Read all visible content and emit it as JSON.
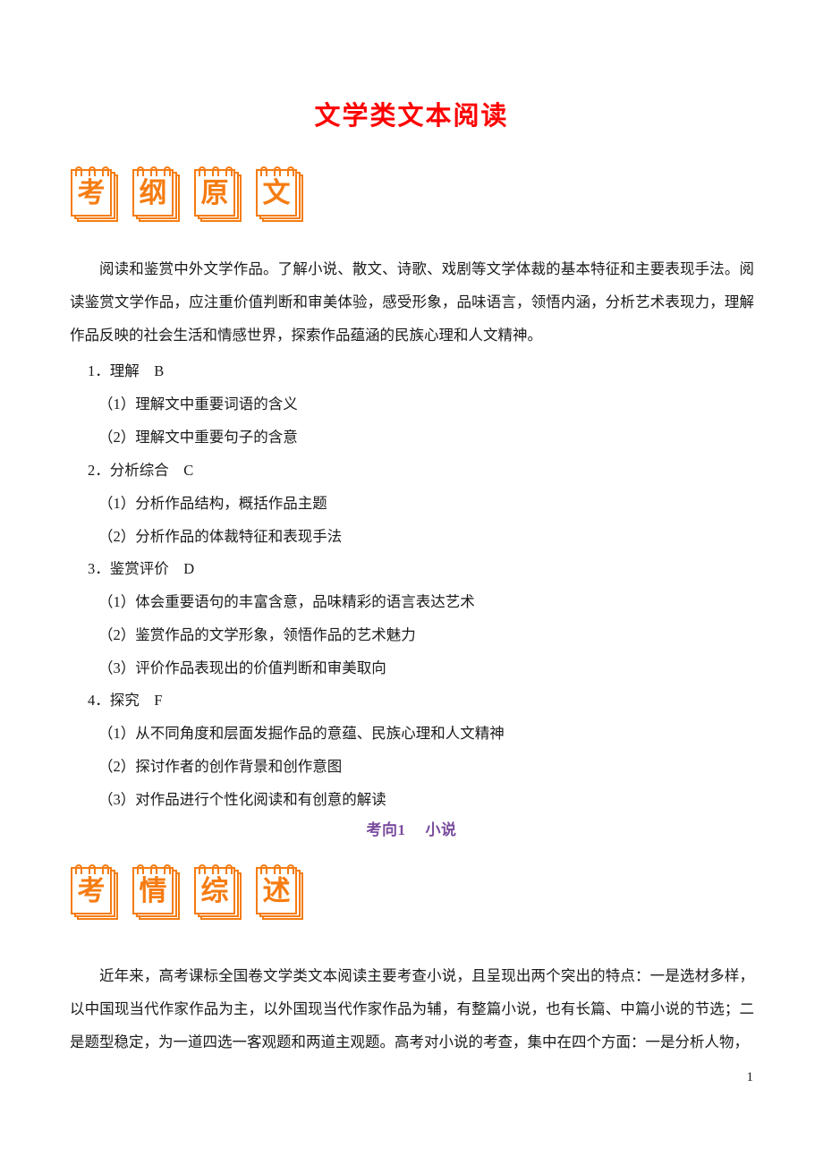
{
  "document": {
    "title": "文学类文本阅读",
    "page_number": "1"
  },
  "banners": [
    {
      "name": "kaogang-yuanwen",
      "chars": [
        "考",
        "纲",
        "原",
        "文"
      ]
    },
    {
      "name": "kaoqing-zongshu",
      "chars": [
        "考",
        "情",
        "综",
        "述"
      ]
    }
  ],
  "intro_paragraph": "阅读和鉴赏中外文学作品。了解小说、散文、诗歌、戏剧等文学体裁的基本特征和主要表现手法。阅读鉴赏文学作品，应注重价值判断和审美体验，感受形象，品味语言，领悟内涵，分析艺术表现力，理解作品反映的社会生活和情感世界，探索作品蕴涵的民族心理和人文精神。",
  "outline": [
    {
      "level": 1,
      "text": "1．理解　B"
    },
    {
      "level": 2,
      "text": "（1）理解文中重要词语的含义"
    },
    {
      "level": 2,
      "text": "（2）理解文中重要句子的含意"
    },
    {
      "level": 1,
      "text": "2．分析综合　C"
    },
    {
      "level": 2,
      "text": "（1）分析作品结构，概括作品主题"
    },
    {
      "level": 2,
      "text": "（2）分析作品的体裁特征和表现手法"
    },
    {
      "level": 1,
      "text": "3．鉴赏评价　D"
    },
    {
      "level": 2,
      "text": "（1）体会重要语句的丰富含意，品味精彩的语言表达艺术"
    },
    {
      "level": 2,
      "text": "（2）鉴赏作品的文学形象，领悟作品的艺术魅力"
    },
    {
      "level": 2,
      "text": "（3）评价作品表现出的价值判断和审美取向"
    },
    {
      "level": 1,
      "text": "4．探究　F"
    },
    {
      "level": 2,
      "text": "（1）从不同角度和层面发掘作品的意蕴、民族心理和人文精神"
    },
    {
      "level": 2,
      "text": "（2）探讨作者的创作背景和创作意图"
    },
    {
      "level": 2,
      "text": "（3）对作品进行个性化阅读和有创意的解读"
    }
  ],
  "section_heading": {
    "label": "考向1",
    "title": "小说"
  },
  "outro_paragraph": "近年来，高考课标全国卷文学类文本阅读主要考查小说，且呈现出两个突出的特点：一是选材多样，以中国现当代作家作品为主，以外国现当代作家作品为辅，有整篇小说，也有长篇、中篇小说的节选；二是题型稳定，为一道四选一客观题和两道主观题。高考对小说的考查，集中在四个方面：一是分析人物，",
  "colors": {
    "title_red": "#FF0000",
    "banner_orange": "#F57C12",
    "heading_purple": "#7B4C9E",
    "body_black": "#1a1a1a"
  }
}
